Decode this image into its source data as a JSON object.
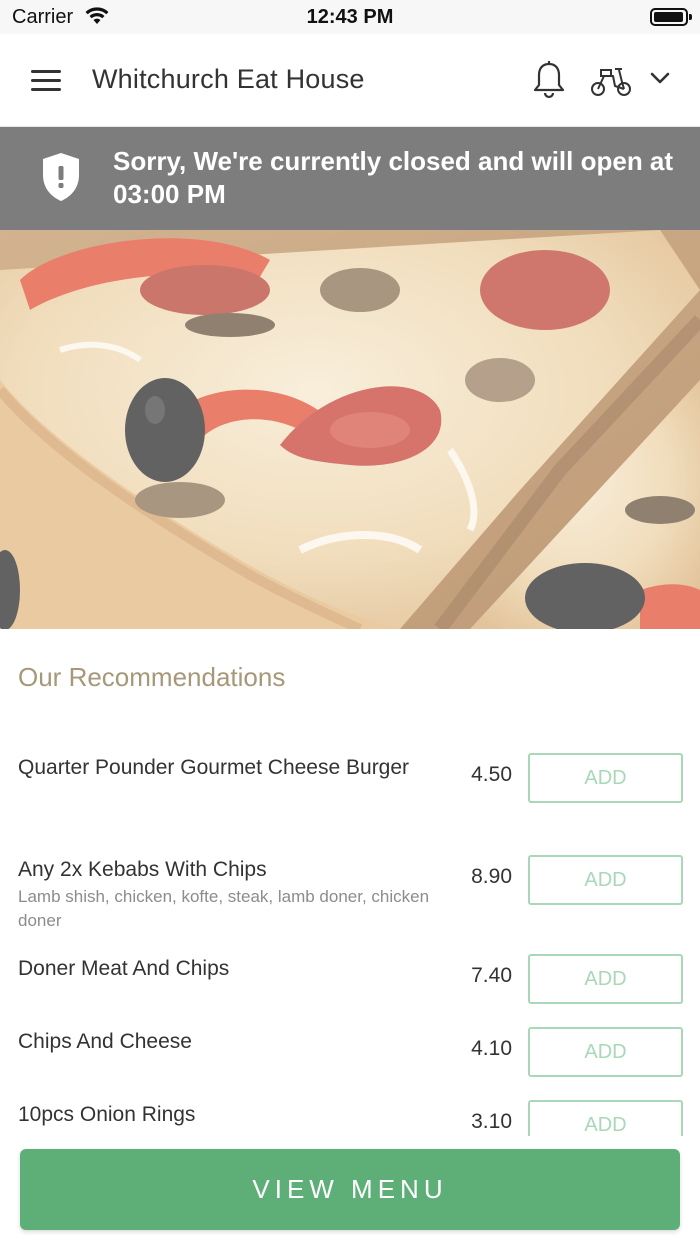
{
  "status_bar": {
    "carrier": "Carrier",
    "time": "12:43 PM"
  },
  "header": {
    "title": "Whitchurch Eat House",
    "icons": [
      "menu-icon",
      "bell-icon",
      "scooter-icon",
      "chevron-down-icon"
    ]
  },
  "banner": {
    "message": "Sorry, We're currently closed and will open at 03:00 PM",
    "icon": "shield-alert-icon",
    "background": "#7d7d7d"
  },
  "recommendations": {
    "title": "Our Recommendations",
    "items": [
      {
        "name": "Quarter Pounder Gourmet Cheese Burger",
        "description": "",
        "price": "4.50",
        "button": "ADD"
      },
      {
        "name": "Any 2x Kebabs With Chips",
        "description": "Lamb shish, chicken, kofte, steak, lamb doner, chicken doner",
        "price": "8.90",
        "button": "ADD"
      },
      {
        "name": "Doner Meat And Chips",
        "description": "",
        "price": "7.40",
        "button": "ADD"
      },
      {
        "name": "Chips And Cheese",
        "description": "",
        "price": "4.10",
        "button": "ADD"
      },
      {
        "name": "10pcs Onion Rings",
        "description": "",
        "price": "3.10",
        "button": "ADD"
      }
    ]
  },
  "footer": {
    "view_menu_label": "VIEW MENU"
  },
  "colors": {
    "accent": "#5eaf77",
    "add_border": "#a8d8b8",
    "section_title": "#a69879"
  }
}
